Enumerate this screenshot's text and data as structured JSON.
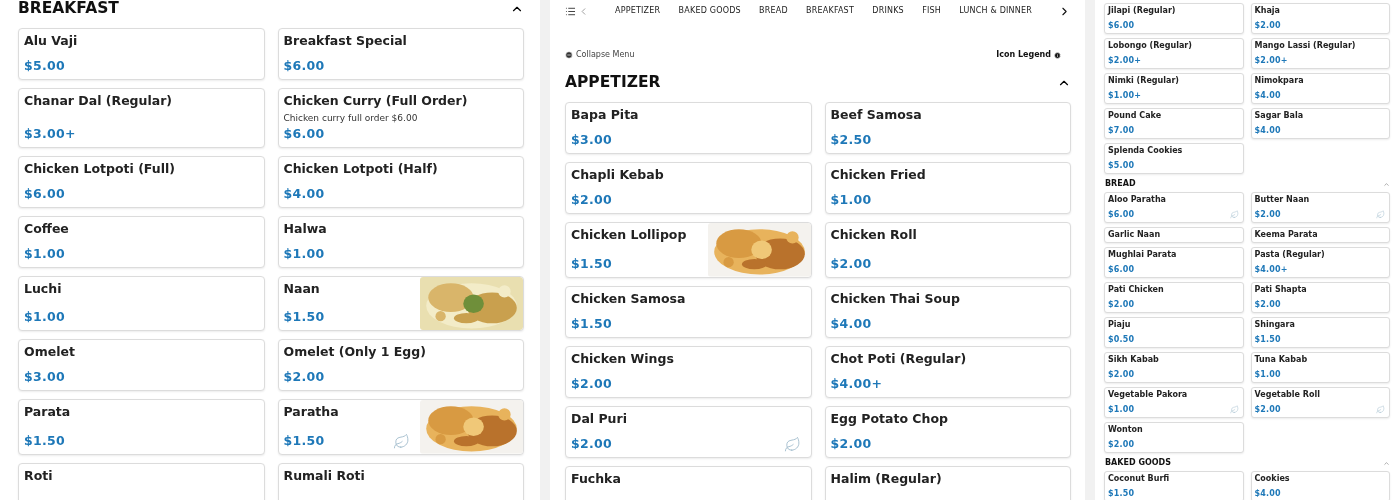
{
  "left": {
    "sections": [
      {
        "title": "BREAKFAST",
        "expanded": true,
        "items": [
          {
            "name": "Alu Vaji",
            "price": "$5.00"
          },
          {
            "name": "Breakfast Special",
            "price": "$6.00"
          },
          {
            "name": "Chanar Dal (Regular)",
            "price": "$3.00+"
          },
          {
            "name": "Chicken Curry (Full Order)",
            "description": "Chicken curry full order $6.00",
            "price": "$6.00"
          },
          {
            "name": "Chicken Lotpoti (Full)",
            "price": "$6.00"
          },
          {
            "name": "Chicken Lotpoti (Half)",
            "price": "$4.00"
          },
          {
            "name": "Coffee",
            "price": "$1.00"
          },
          {
            "name": "Halwa",
            "price": "$1.00"
          },
          {
            "name": "Luchi",
            "price": "$1.00"
          },
          {
            "name": "Naan",
            "price": "$1.50"
          },
          {
            "name": "Omelet",
            "price": "$3.00"
          },
          {
            "name": "Omelet (Only 1 Egg)",
            "price": "$2.00"
          },
          {
            "name": "Parata",
            "price": "$1.50"
          },
          {
            "name": "Paratha",
            "price": "$1.50",
            "leaf": true
          },
          {
            "name": "Roti"
          },
          {
            "name": "Rumali Roti"
          }
        ]
      }
    ]
  },
  "middle": {
    "nav": {
      "tabs": [
        {
          "label": "APPETIZER",
          "selected": false
        },
        {
          "label": "BAKED GOODS",
          "selected": false
        },
        {
          "label": "BREAD",
          "selected": false
        },
        {
          "label": "BREAKFAST",
          "selected": false
        },
        {
          "label": "DRINKS",
          "selected": false
        },
        {
          "label": "FISH",
          "selected": false
        },
        {
          "label": "LUNCH & DINNER",
          "selected": false
        }
      ]
    },
    "collapse_menu": "Collapse Menu",
    "icon_legend": "Icon Legend",
    "sections": [
      {
        "title": "APPETIZER",
        "expanded": true,
        "items": [
          {
            "name": "Bapa Pita",
            "price": "$3.00"
          },
          {
            "name": "Beef Samosa",
            "price": "$2.50"
          },
          {
            "name": "Chapli Kebab",
            "price": "$2.00"
          },
          {
            "name": "Chicken Fried",
            "price": "$1.00"
          },
          {
            "name": "Chicken Lollipop",
            "price": "$1.50"
          },
          {
            "name": "Chicken Roll",
            "price": "$2.00"
          },
          {
            "name": "Chicken Samosa",
            "price": "$1.50"
          },
          {
            "name": "Chicken Thai Soup",
            "price": "$4.00"
          },
          {
            "name": "Chicken Wings",
            "price": "$2.00"
          },
          {
            "name": "Chot Poti (Regular)",
            "price": "$4.00+"
          },
          {
            "name": "Dal Puri",
            "price": "$2.00",
            "leaf": true
          },
          {
            "name": "Egg Potato Chop",
            "price": "$2.00"
          },
          {
            "name": "Fuchka"
          },
          {
            "name": "Halim (Regular)"
          }
        ]
      }
    ]
  },
  "right": {
    "sections": [
      {
        "items": [
          {
            "name": "Jilapi (Regular)",
            "price": "$6.00"
          },
          {
            "name": "Khaja",
            "price": "$2.00"
          },
          {
            "name": "Lobongo (Regular)",
            "price": "$2.00+"
          },
          {
            "name": "Mango Lassi (Regular)",
            "price": "$2.00+"
          },
          {
            "name": "Nimki (Regular)",
            "price": "$1.00+"
          },
          {
            "name": "Nimokpara",
            "price": "$4.00"
          },
          {
            "name": "Pound Cake",
            "price": "$7.00"
          },
          {
            "name": "Sagar Bala",
            "price": "$4.00"
          },
          {
            "name": "Splenda Cookies",
            "price": "$5.00"
          }
        ]
      },
      {
        "title": "BREAD",
        "expanded": true,
        "items": [
          {
            "name": "Aloo Paratha",
            "price": "$6.00",
            "leaf": true
          },
          {
            "name": "Butter Naan",
            "price": "$2.00",
            "leaf": true
          },
          {
            "name": "Garlic Naan"
          },
          {
            "name": "Keema Parata"
          },
          {
            "name": "Mughlai Parata",
            "price": "$6.00"
          },
          {
            "name": "Pasta (Regular)",
            "price": "$4.00+"
          },
          {
            "name": "Pati Chicken",
            "price": "$2.00"
          },
          {
            "name": "Pati Shapta",
            "price": "$2.00"
          },
          {
            "name": "Piaju",
            "price": "$0.50"
          },
          {
            "name": "Shingara",
            "price": "$1.50"
          },
          {
            "name": "Sikh Kabab",
            "price": "$2.00"
          },
          {
            "name": "Tuna Kabab",
            "price": "$1.00"
          },
          {
            "name": "Vegetable Pakora",
            "price": "$1.00",
            "leaf": true
          },
          {
            "name": "Vegetable Roll",
            "price": "$2.00",
            "leaf": true
          },
          {
            "name": "Wonton",
            "price": "$2.00"
          }
        ]
      },
      {
        "title": "BAKED GOODS",
        "expanded": true,
        "items": [
          {
            "name": "Coconut Burfi",
            "price": "$1.50"
          },
          {
            "name": "Cookies",
            "price": "$4.00"
          }
        ]
      }
    ]
  }
}
